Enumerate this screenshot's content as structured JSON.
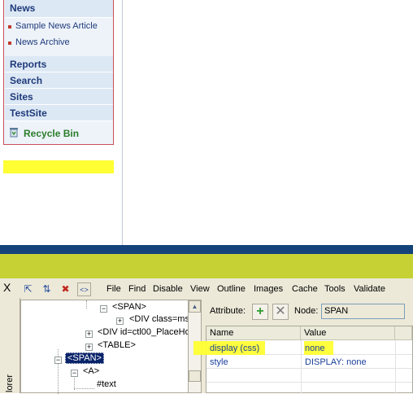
{
  "quick_launch": {
    "news": "News",
    "news_items": [
      "Sample News Article",
      "News Archive"
    ],
    "sections": [
      "Reports",
      "Search",
      "Sites",
      "TestSite"
    ],
    "recycle_bin": "Recycle Bin"
  },
  "devtoolbar": {
    "close_glyph": "X",
    "menu": [
      "File",
      "Find",
      "Disable",
      "View",
      "Outline",
      "Images",
      "Cache",
      "Tools",
      "Validate"
    ],
    "side_tab_label": "lorer",
    "tree": {
      "span_inner": "<SPAN>",
      "div_class": "<DIV class=ms-",
      "div_id": "<DIV id=ctl00_PlaceHol",
      "table": "<TABLE>",
      "span_selected": "<SPAN>",
      "anchor": "<A>",
      "text_node": "#text"
    },
    "attributes": {
      "attribute_label": "Attribute:",
      "node_label": "Node:",
      "node_value": "SPAN",
      "columns": [
        "Name",
        "Value"
      ],
      "rows": [
        {
          "name": "display (css)",
          "value": "none"
        },
        {
          "name": "style",
          "value": "DISPLAY: none"
        }
      ]
    }
  },
  "colors": {
    "highlight": "#ffff33",
    "navy_band": "#14437c",
    "lime_band": "#c6d134",
    "selection": "#0a246a"
  }
}
